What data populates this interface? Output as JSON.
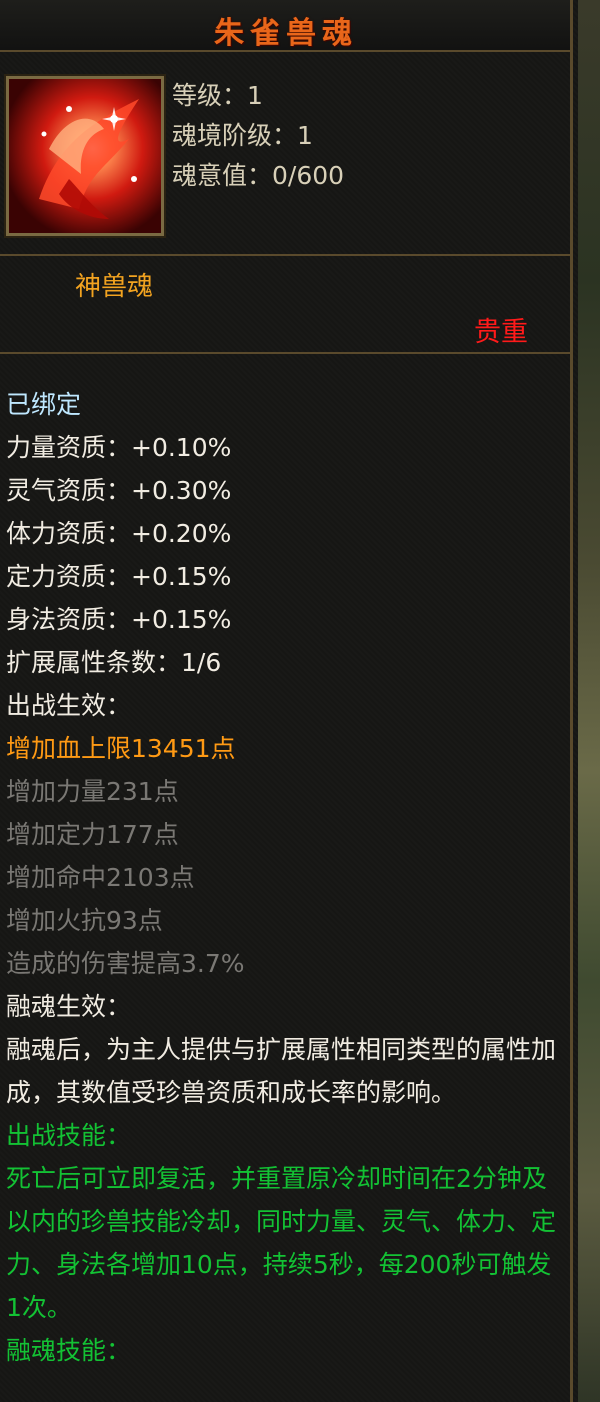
{
  "title": "朱雀兽魂",
  "portrait": {
    "icon": "phoenix-icon"
  },
  "stats": [
    {
      "label": "等级：1"
    },
    {
      "label": "魂境阶级：1"
    },
    {
      "label": "魂意值：0/600"
    }
  ],
  "category": "神兽魂",
  "rarity": "贵重",
  "body": {
    "bound": "已绑定",
    "aptitudes": [
      "力量资质：+0.10%",
      "灵气资质：+0.30%",
      "体力资质：+0.20%",
      "定力资质：+0.15%",
      "身法资质：+0.15%"
    ],
    "ext_count": "扩展属性条数：1/6",
    "battle_header": "出战生效：",
    "active_effect": "增加血上限13451点",
    "inactive_effects": [
      "增加力量231点",
      "增加定力177点",
      "增加命中2103点",
      "增加火抗93点",
      "造成的伤害提高3.7%"
    ],
    "fuse_header": "融魂生效：",
    "fuse_desc": "融魂后，为主人提供与扩展属性相同类型的属性加成，其数值受珍兽资质和成长率的影响。",
    "skill_header": "出战技能：",
    "skill_desc": "死亡后可立即复活，并重置原冷却时间在2分钟及以内的珍兽技能冷却，同时力量、灵气、体力、定力、身法各增加10点，持续5秒，每200秒可触发1次。",
    "fuse_skill_header": "融魂技能："
  },
  "colors": {
    "title": "#e9661a",
    "category": "#f2a320",
    "rarity": "#ff1a1a",
    "bound": "#bfe8ff",
    "active": "#ff9a14",
    "inactive": "#7a7874",
    "skill": "#13c234"
  }
}
